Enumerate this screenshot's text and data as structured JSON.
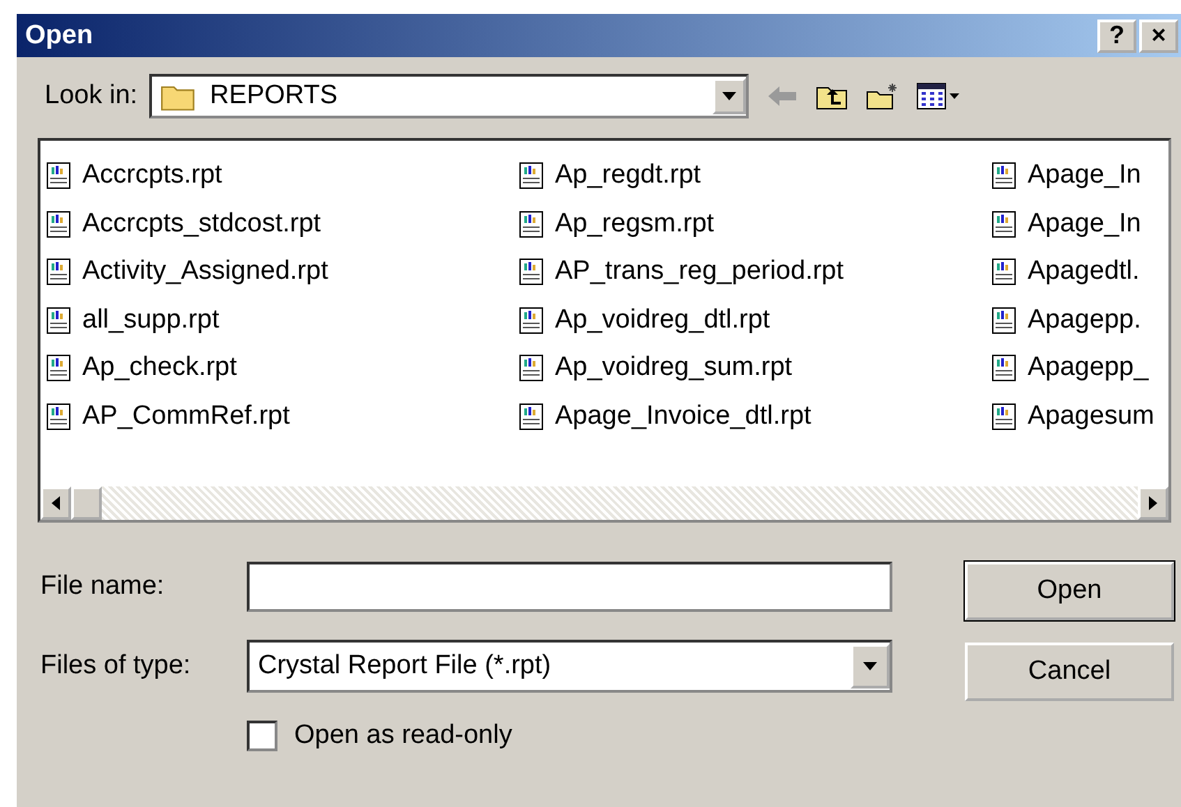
{
  "window": {
    "title": "Open",
    "help_button": "?",
    "close_button": "×"
  },
  "look_in": {
    "label": "Look in:",
    "value": "REPORTS"
  },
  "files": [
    {
      "name": "Accrcpts.rpt"
    },
    {
      "name": "Accrcpts_stdcost.rpt"
    },
    {
      "name": "Activity_Assigned.rpt"
    },
    {
      "name": "all_supp.rpt"
    },
    {
      "name": "Ap_check.rpt"
    },
    {
      "name": "AP_CommRef.rpt"
    },
    {
      "name": "Ap_regdt.rpt"
    },
    {
      "name": "Ap_regsm.rpt"
    },
    {
      "name": "AP_trans_reg_period.rpt"
    },
    {
      "name": "Ap_voidreg_dtl.rpt"
    },
    {
      "name": "Ap_voidreg_sum.rpt"
    },
    {
      "name": "Apage_Invoice_dtl.rpt"
    },
    {
      "name": "Apage_In"
    },
    {
      "name": "Apage_In"
    },
    {
      "name": "Apagedtl."
    },
    {
      "name": "Apagepp."
    },
    {
      "name": "Apagepp_"
    },
    {
      "name": "Apagesum"
    }
  ],
  "file_name": {
    "label": "File name:"
  },
  "file_type": {
    "label": "Files of type:",
    "value": "Crystal Report File (*.rpt)"
  },
  "read_only": {
    "label": "Open as read-only",
    "checked": false
  },
  "buttons": [
    "Open",
    "Cancel"
  ]
}
